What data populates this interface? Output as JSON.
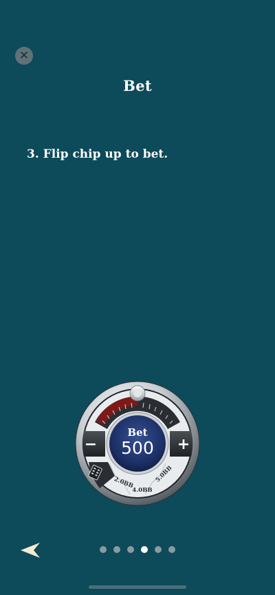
{
  "header": {
    "close_icon": "close-icon",
    "close_glyph": "✕",
    "title": "Bet"
  },
  "instruction": {
    "text": "3. Flip chip up to bet."
  },
  "bet_dial": {
    "label": "Bet",
    "amount": "500",
    "minus_glyph": "−",
    "plus_glyph": "+",
    "presets": [
      "2.0BB",
      "4.0BB",
      "5.0BB"
    ],
    "keypad_icon": "keypad-icon"
  },
  "footer": {
    "back_icon": "back-arrow-icon",
    "pages": 6,
    "active_page": 4
  },
  "colors": {
    "background": "#0d4a5a",
    "accent_red": "#b11a1a",
    "dial_center": "#1c2f66"
  }
}
